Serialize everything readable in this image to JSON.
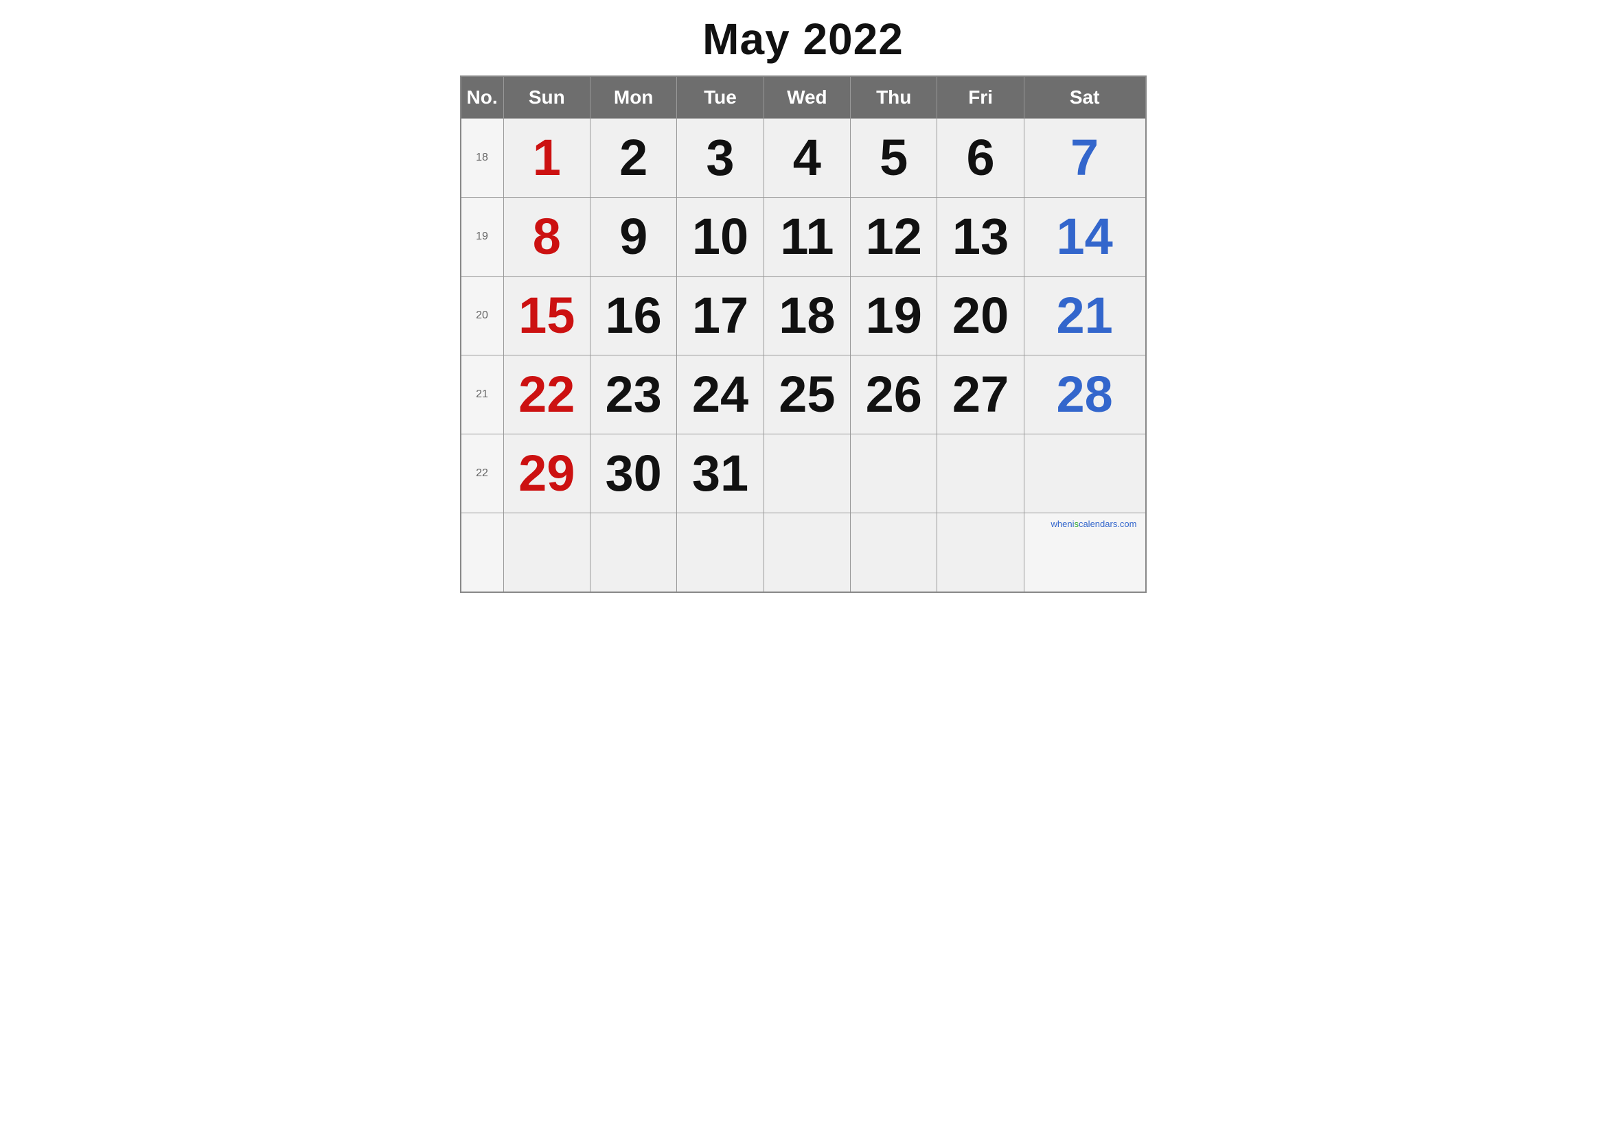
{
  "title": "May 2022",
  "header": {
    "no_label": "No.",
    "days": [
      "Sun",
      "Mon",
      "Tue",
      "Wed",
      "Thu",
      "Fri",
      "Sat"
    ]
  },
  "weeks": [
    {
      "week_no": "18",
      "days": [
        {
          "num": "1",
          "color": "red"
        },
        {
          "num": "2",
          "color": "black"
        },
        {
          "num": "3",
          "color": "black"
        },
        {
          "num": "4",
          "color": "black"
        },
        {
          "num": "5",
          "color": "black"
        },
        {
          "num": "6",
          "color": "black"
        },
        {
          "num": "7",
          "color": "blue"
        }
      ]
    },
    {
      "week_no": "19",
      "days": [
        {
          "num": "8",
          "color": "red"
        },
        {
          "num": "9",
          "color": "black"
        },
        {
          "num": "10",
          "color": "black"
        },
        {
          "num": "11",
          "color": "black"
        },
        {
          "num": "12",
          "color": "black"
        },
        {
          "num": "13",
          "color": "black"
        },
        {
          "num": "14",
          "color": "blue"
        }
      ]
    },
    {
      "week_no": "20",
      "days": [
        {
          "num": "15",
          "color": "red"
        },
        {
          "num": "16",
          "color": "black"
        },
        {
          "num": "17",
          "color": "black"
        },
        {
          "num": "18",
          "color": "black"
        },
        {
          "num": "19",
          "color": "black"
        },
        {
          "num": "20",
          "color": "black"
        },
        {
          "num": "21",
          "color": "blue"
        }
      ]
    },
    {
      "week_no": "21",
      "days": [
        {
          "num": "22",
          "color": "red"
        },
        {
          "num": "23",
          "color": "black"
        },
        {
          "num": "24",
          "color": "black"
        },
        {
          "num": "25",
          "color": "black"
        },
        {
          "num": "26",
          "color": "black"
        },
        {
          "num": "27",
          "color": "black"
        },
        {
          "num": "28",
          "color": "blue"
        }
      ]
    },
    {
      "week_no": "22",
      "days": [
        {
          "num": "29",
          "color": "red"
        },
        {
          "num": "30",
          "color": "black"
        },
        {
          "num": "31",
          "color": "black"
        },
        {
          "num": "",
          "color": ""
        },
        {
          "num": "",
          "color": ""
        },
        {
          "num": "",
          "color": ""
        },
        {
          "num": "",
          "color": ""
        }
      ]
    }
  ],
  "watermark": {
    "text_green": "is",
    "text_prefix": "wheni",
    "text_suffix": "calendars.com"
  }
}
